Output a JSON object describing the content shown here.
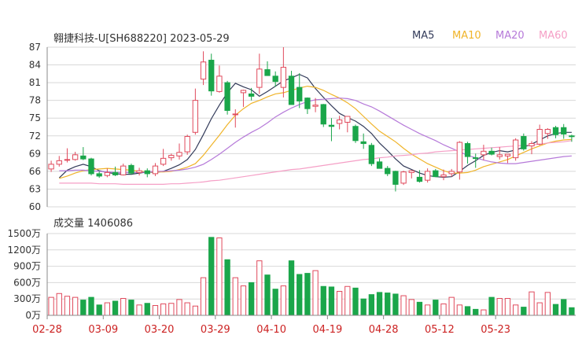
{
  "chart_title": "翱捷科技-U[SH688220] 2023-05-29",
  "ma_legend": [
    {
      "label": "MA5",
      "color": "#333b5a"
    },
    {
      "label": "MA10",
      "color": "#f0b429"
    },
    {
      "label": "MA20",
      "color": "#b67ad9"
    },
    {
      "label": "MA60",
      "color": "#f59fc6"
    }
  ],
  "volume_title": "成交量 1406086",
  "colors": {
    "up": "#e04a5c",
    "down": "#1aa64a",
    "grid": "#d8d8d8",
    "axis": "#8a8a8a",
    "date": "#cc2222"
  },
  "chart_data": [
    {
      "type": "candlestick",
      "ylim": [
        60,
        87
      ],
      "yticks": [
        "87",
        "84",
        "81",
        "78",
        "75",
        "72",
        "69",
        "66",
        "63",
        "60"
      ],
      "xticks": [
        {
          "label": "02-28",
          "index": 0
        },
        {
          "label": "03-09",
          "index": 7
        },
        {
          "label": "03-20",
          "index": 14
        },
        {
          "label": "03-29",
          "index": 21
        },
        {
          "label": "04-10",
          "index": 28
        },
        {
          "label": "04-19",
          "index": 35
        },
        {
          "label": "04-28",
          "index": 42
        },
        {
          "label": "05-12",
          "index": 49
        },
        {
          "label": "05-23",
          "index": 56
        }
      ],
      "ohlc": [
        [
          66.4,
          67.8,
          65.9,
          67.2
        ],
        [
          67.2,
          68.6,
          66.8,
          67.8
        ],
        [
          67.9,
          69.9,
          67.5,
          68.0
        ],
        [
          68.0,
          69.3,
          67.8,
          68.8
        ],
        [
          68.6,
          70.1,
          67.9,
          68.1
        ],
        [
          68.1,
          68.3,
          65.3,
          65.6
        ],
        [
          65.6,
          66.0,
          64.9,
          65.2
        ],
        [
          65.3,
          66.5,
          65.0,
          65.8
        ],
        [
          65.8,
          66.8,
          65.2,
          65.4
        ],
        [
          65.4,
          67.3,
          65.3,
          66.9
        ],
        [
          67.0,
          67.3,
          65.4,
          65.7
        ],
        [
          65.8,
          66.6,
          65.3,
          66.1
        ],
        [
          66.1,
          66.5,
          65.0,
          65.6
        ],
        [
          65.6,
          67.4,
          65.2,
          66.9
        ],
        [
          67.2,
          69.8,
          66.9,
          68.2
        ],
        [
          68.3,
          69.0,
          67.8,
          68.7
        ],
        [
          68.6,
          70.7,
          68.0,
          69.2
        ],
        [
          69.3,
          72.2,
          68.8,
          71.9
        ],
        [
          72.6,
          80.0,
          72.2,
          78.0
        ],
        [
          81.6,
          86.3,
          80.6,
          84.5
        ],
        [
          84.8,
          85.9,
          78.8,
          79.6
        ],
        [
          79.5,
          83.9,
          79.3,
          82.1
        ],
        [
          81.0,
          81.3,
          75.6,
          76.3
        ],
        [
          75.6,
          76.5,
          73.4,
          75.7
        ],
        [
          79.3,
          79.8,
          76.9,
          79.7
        ],
        [
          79.1,
          80.1,
          78.0,
          78.7
        ],
        [
          80.2,
          85.9,
          79.1,
          83.3
        ],
        [
          83.2,
          84.6,
          82.2,
          82.2
        ],
        [
          82.1,
          82.9,
          80.3,
          81.2
        ],
        [
          80.2,
          87.0,
          78.5,
          83.6
        ],
        [
          82.1,
          83.0,
          79.4,
          77.3
        ],
        [
          80.2,
          82.6,
          76.7,
          77.9
        ],
        [
          78.4,
          78.5,
          75.7,
          76.6
        ],
        [
          77.0,
          78.4,
          76.0,
          77.2
        ],
        [
          77.3,
          77.4,
          73.5,
          74.0
        ],
        [
          73.8,
          75.0,
          71.1,
          73.6
        ],
        [
          74.1,
          75.4,
          73.1,
          74.7
        ],
        [
          74.3,
          75.2,
          72.6,
          75.3
        ],
        [
          73.6,
          73.9,
          70.8,
          71.2
        ],
        [
          71.0,
          72.4,
          69.8,
          70.7
        ],
        [
          70.4,
          70.8,
          66.9,
          67.3
        ],
        [
          67.6,
          68.2,
          66.9,
          66.5
        ],
        [
          66.5,
          66.9,
          65.2,
          65.6
        ],
        [
          66.0,
          66.1,
          62.6,
          63.8
        ],
        [
          64.0,
          66.1,
          63.7,
          65.9
        ],
        [
          65.8,
          66.2,
          64.8,
          66.1
        ],
        [
          65.0,
          66.2,
          64.1,
          64.3
        ],
        [
          64.5,
          66.5,
          64.1,
          66.0
        ],
        [
          66.1,
          66.4,
          65.1,
          65.1
        ],
        [
          65.1,
          66.3,
          64.5,
          65.4
        ],
        [
          65.6,
          66.4,
          65.1,
          66.0
        ],
        [
          65.9,
          71.1,
          64.6,
          70.9
        ],
        [
          70.7,
          71.0,
          67.3,
          68.5
        ],
        [
          68.3,
          69.0,
          66.6,
          68.2
        ],
        [
          68.8,
          70.5,
          67.9,
          69.4
        ],
        [
          69.4,
          70.0,
          68.7,
          68.9
        ],
        [
          68.5,
          70.1,
          68.0,
          68.8
        ],
        [
          68.6,
          68.7,
          67.4,
          68.9
        ],
        [
          68.3,
          71.6,
          67.8,
          71.3
        ],
        [
          71.9,
          72.4,
          69.5,
          69.8
        ],
        [
          70.3,
          71.1,
          68.9,
          70.7
        ],
        [
          70.6,
          73.9,
          70.4,
          73.1
        ],
        [
          72.4,
          73.3,
          71.5,
          73.1
        ],
        [
          73.4,
          73.7,
          71.6,
          72.2
        ],
        [
          73.4,
          74.0,
          71.5,
          72.3
        ],
        [
          72.0,
          72.2,
          71.0,
          71.9
        ]
      ],
      "ma_lines": {
        "MA5": [
          64.9,
          66.2,
          66.8,
          67.2,
          66.8,
          66.1,
          65.8,
          65.6,
          65.5,
          65.5,
          65.7,
          65.9,
          65.8,
          66.0,
          66.5,
          67.1,
          68.0,
          69.7,
          72.2,
          74.9,
          77.2,
          79.3,
          80.9,
          80.3,
          79.8,
          78.7,
          79.5,
          80.4,
          81.3,
          81.8,
          82.4,
          81.8,
          80.0,
          78.5,
          77.1,
          75.8,
          75.1,
          74.5,
          73.6,
          72.4,
          70.8,
          69.5,
          68.1,
          66.9,
          66.3,
          65.7,
          65.3,
          65.1,
          65.0,
          65.1,
          66.0,
          67.0,
          67.8,
          68.7,
          69.2,
          69.5,
          69.3,
          69.6,
          70.1,
          70.6,
          71.3,
          72.0,
          72.4,
          72.6,
          72.6
        ],
        "MA10": [
          64.8,
          65.2,
          65.7,
          66.1,
          66.3,
          66.4,
          66.5,
          66.4,
          66.3,
          66.2,
          66.0,
          65.9,
          65.9,
          65.9,
          66.0,
          66.3,
          66.7,
          67.3,
          68.7,
          70.4,
          72.1,
          73.9,
          75.5,
          76.6,
          77.5,
          78.0,
          78.6,
          79.1,
          79.3,
          79.7,
          80.1,
          80.4,
          80.2,
          79.7,
          79.0,
          78.4,
          77.6,
          76.6,
          75.3,
          74.0,
          72.8,
          71.9,
          71.0,
          69.9,
          68.9,
          68.1,
          67.3,
          66.7,
          66.1,
          65.7,
          65.7,
          65.8,
          66.2,
          66.8,
          67.2,
          67.6,
          68.0,
          68.6,
          69.2,
          69.8,
          70.3,
          70.8,
          71.1,
          71.3,
          71.4
        ],
        "MA20": [
          66.1,
          66.1,
          66.2,
          66.2,
          66.1,
          66.0,
          65.9,
          65.8,
          65.8,
          65.8,
          65.8,
          65.9,
          66.0,
          66.0,
          66.1,
          66.2,
          66.4,
          66.7,
          67.2,
          68.0,
          68.9,
          69.9,
          70.9,
          71.8,
          72.6,
          73.3,
          74.2,
          75.2,
          76.0,
          76.7,
          77.3,
          77.8,
          78.1,
          78.2,
          78.3,
          78.4,
          78.3,
          78.0,
          77.4,
          76.9,
          76.2,
          75.4,
          74.6,
          73.8,
          73.1,
          72.4,
          71.8,
          71.2,
          70.5,
          69.9,
          69.3,
          68.7,
          68.3,
          67.9,
          67.6,
          67.4,
          67.3,
          67.3,
          67.5,
          67.7,
          67.9,
          68.1,
          68.3,
          68.5,
          68.6
        ],
        "MA60": [
          64.0,
          64.0,
          64.0,
          64.0,
          64.0,
          63.9,
          63.9,
          63.9,
          63.8,
          63.8,
          63.8,
          63.8,
          63.8,
          63.8,
          63.9,
          63.9,
          64.0,
          64.1,
          64.2,
          64.4,
          64.5,
          64.7,
          64.9,
          65.1,
          65.3,
          65.5,
          65.7,
          65.9,
          66.1,
          66.3,
          66.4,
          66.6,
          66.8,
          67.0,
          67.2,
          67.4,
          67.6,
          67.8,
          68.0,
          68.1,
          68.3,
          68.4,
          68.6,
          68.7,
          68.8,
          69.0,
          69.1,
          69.3,
          69.4,
          69.5,
          69.6,
          69.7,
          69.8,
          69.9,
          70.0,
          70.1,
          70.2,
          70.3,
          70.4,
          70.5,
          70.6,
          70.8,
          70.9,
          71.0,
          71.2
        ]
      }
    },
    {
      "type": "bar",
      "series_name": "成交量",
      "ylim": [
        0,
        1500
      ],
      "yticks": [
        "1500万",
        "1200万",
        "900万",
        "600万",
        "300万",
        "0万"
      ],
      "values": [
        330,
        400,
        350,
        330,
        280,
        330,
        190,
        230,
        260,
        310,
        280,
        190,
        220,
        180,
        210,
        220,
        290,
        230,
        170,
        690,
        1430,
        1420,
        1020,
        690,
        540,
        600,
        1000,
        740,
        480,
        540,
        1000,
        750,
        770,
        820,
        530,
        520,
        440,
        530,
        500,
        300,
        380,
        420,
        410,
        390,
        360,
        290,
        240,
        190,
        280,
        210,
        330,
        190,
        160,
        110,
        100,
        330,
        310,
        310,
        190,
        150,
        430,
        230,
        420,
        200,
        290,
        140
      ]
    }
  ]
}
